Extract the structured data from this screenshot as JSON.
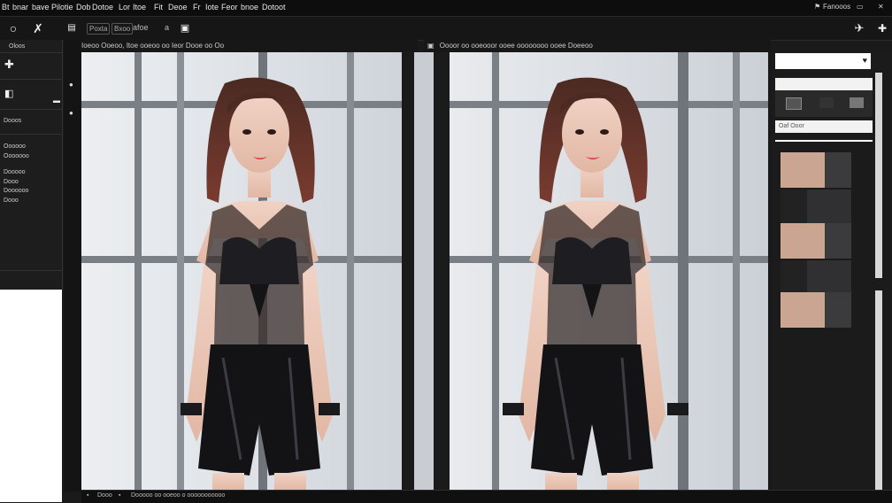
{
  "menubar": {
    "items": [
      "Bt",
      "bnar",
      "bave",
      "Pilotie",
      "Dob",
      "Dotoe",
      "Lor",
      "Itoe"
    ],
    "extra": [
      "Fit",
      "Deoe",
      "Fr",
      "Iote",
      "Feor",
      "bnoe",
      "Dotoot"
    ],
    "right_label": "Fanooos"
  },
  "toolbar": {
    "box1": "Poxta",
    "box2": "Bxoo",
    "label1": "afoe",
    "letter": "a",
    "header_left": "Ioeoo Ooeoo, Itoe ooeoo oo Ieor Dooe oo Oo",
    "header_right": "Oooor oo ooeooor ooee oooooooo ooee Doeeoo"
  },
  "leftpanel": {
    "label_top": "Oloos",
    "label_a": "Dooos",
    "label_b": "Oooooo",
    "label_c": "Ooooooo",
    "label_d": "Dooooo",
    "label_e": "Dooo",
    "label_f": "Doooooo",
    "label_g": "Dooo"
  },
  "rightpanel": {
    "section1": "",
    "section2": "Oaf Ooor"
  },
  "statusbar": {
    "left": "Dooo",
    "mid": "Dooooo oo ooeoo o ooooooooooo",
    "right": ""
  },
  "colors": {
    "accent_red": "#d9343e",
    "ui_dark": "#1b1b1b"
  }
}
